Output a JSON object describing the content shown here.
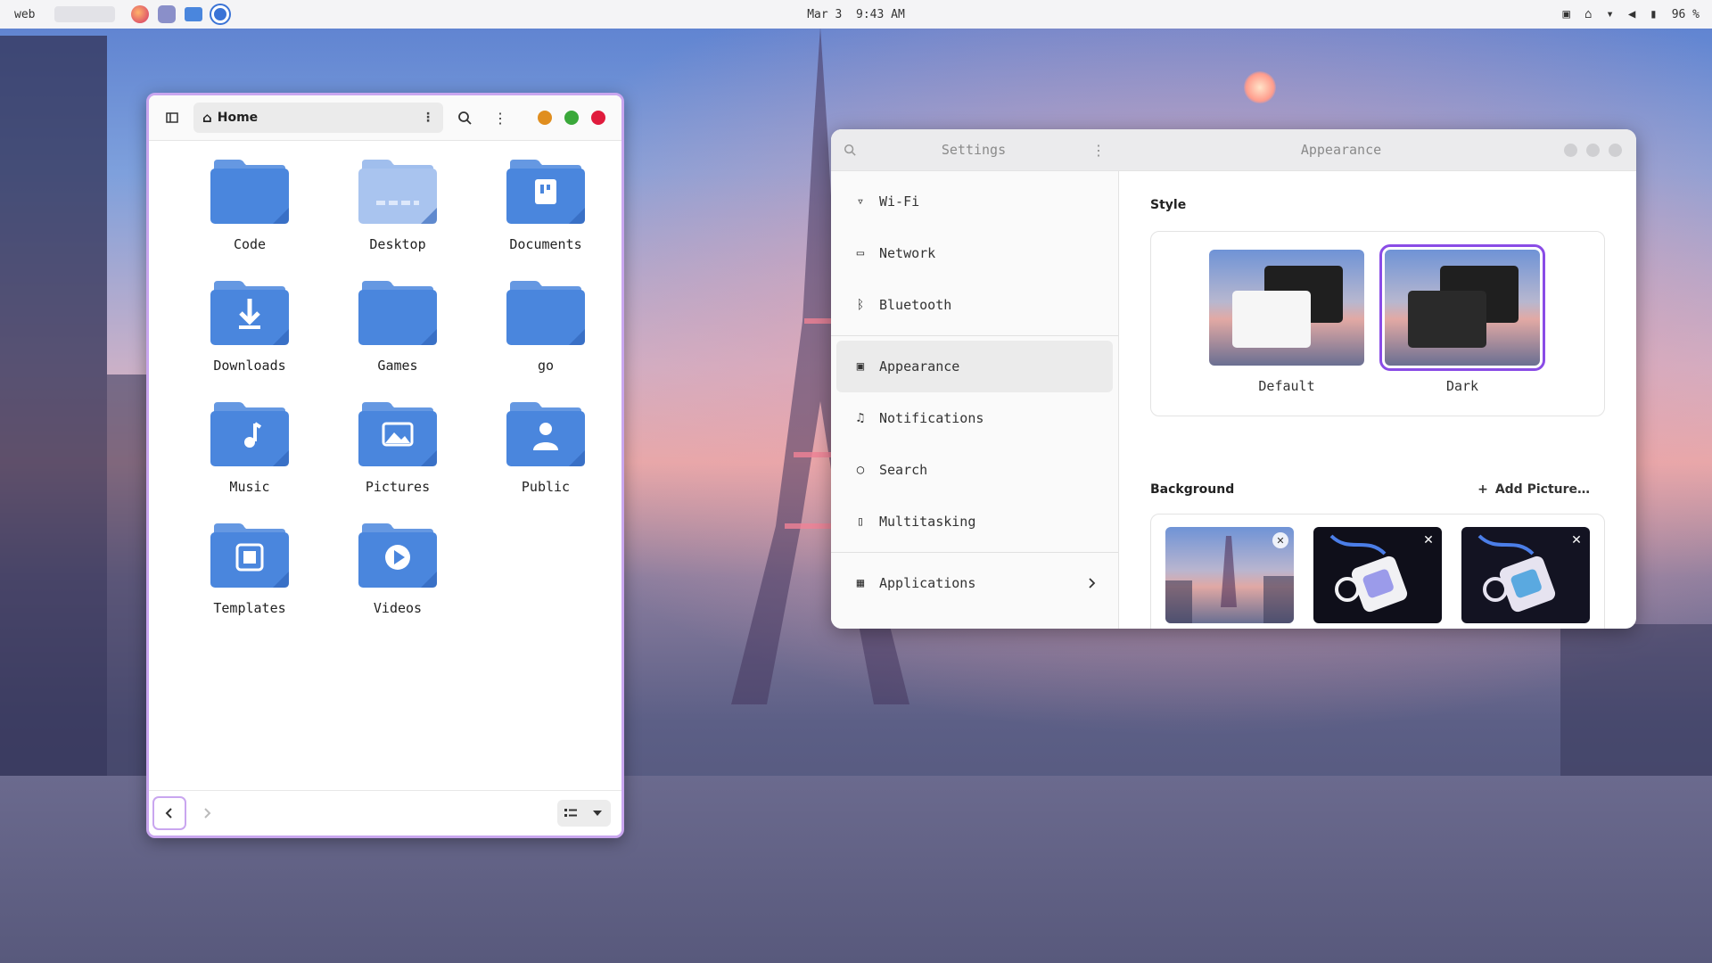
{
  "topbar": {
    "workspace": "web",
    "date": "Mar 3",
    "time": "9:43 AM",
    "battery": "96 %"
  },
  "files": {
    "location": "Home",
    "folders": [
      {
        "label": "Code",
        "glyph": ""
      },
      {
        "label": "Desktop",
        "glyph": "desktop"
      },
      {
        "label": "Documents",
        "glyph": "doc"
      },
      {
        "label": "Downloads",
        "glyph": "down"
      },
      {
        "label": "Games",
        "glyph": ""
      },
      {
        "label": "go",
        "glyph": ""
      },
      {
        "label": "Music",
        "glyph": "music"
      },
      {
        "label": "Pictures",
        "glyph": "picture"
      },
      {
        "label": "Public",
        "glyph": "person"
      },
      {
        "label": "Templates",
        "glyph": "template"
      },
      {
        "label": "Videos",
        "glyph": "play"
      }
    ]
  },
  "settings": {
    "sidebar_title": "Settings",
    "page_title": "Appearance",
    "items": [
      {
        "label": "Wi-Fi",
        "icon": "wifi-icon"
      },
      {
        "label": "Network",
        "icon": "network-icon"
      },
      {
        "label": "Bluetooth",
        "icon": "bluetooth-icon"
      },
      {
        "label": "Appearance",
        "icon": "appearance-icon"
      },
      {
        "label": "Notifications",
        "icon": "bell-icon"
      },
      {
        "label": "Search",
        "icon": "search-icon"
      },
      {
        "label": "Multitasking",
        "icon": "multitasking-icon"
      },
      {
        "label": "Applications",
        "icon": "apps-icon"
      }
    ],
    "style_title": "Style",
    "style_default": "Default",
    "style_dark": "Dark",
    "background_title": "Background",
    "add_picture": "Add Picture…"
  },
  "colors": {
    "accent": "#8a4ce6",
    "folder": "#4a86dd",
    "close": "#e01b3c",
    "maximize": "#3aa83a",
    "minimize": "#e08e1f"
  }
}
